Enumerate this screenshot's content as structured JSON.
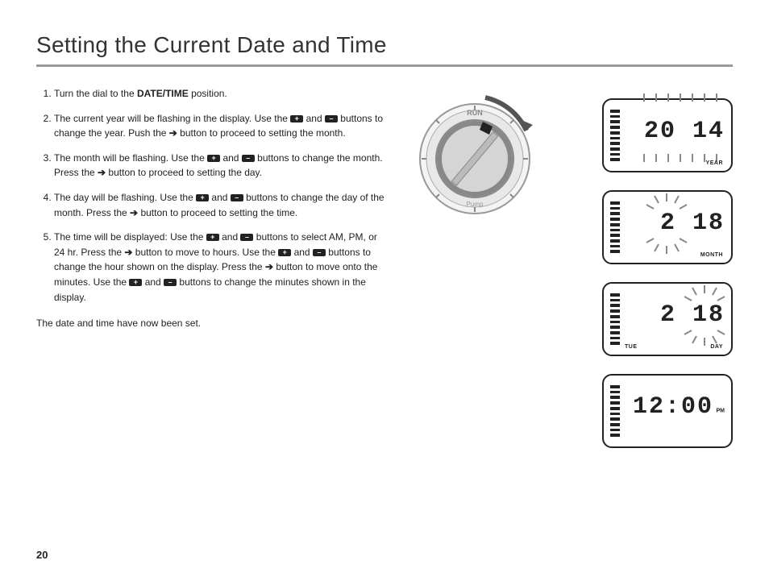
{
  "title": "Setting the Current Date and Time",
  "steps": {
    "s1_a": "Turn the dial to the ",
    "s1_bold": "DATE/TIME",
    "s1_b": " position.",
    "s2_a": "The current year will be flashing in the display. Use the ",
    "s2_b": " and ",
    "s2_c": " buttons to change the year. Push the ",
    "s2_d": " button to proceed to setting the month.",
    "s3_a": "The month will be flashing. Use the ",
    "s3_b": " and ",
    "s3_c": " buttons to change the month. Press the ",
    "s3_d": " button to proceed to setting the day.",
    "s4_a": "The day will be flashing. Use the ",
    "s4_b": " and ",
    "s4_c": " buttons to change the day of the month. Press the ",
    "s4_d": " button to proceed to setting the time.",
    "s5_a": "The time will be displayed: Use the ",
    "s5_b": " and ",
    "s5_c": " buttons to select AM, PM, or 24 hr. Press the ",
    "s5_d": " button to move to hours. Use the ",
    "s5_e": " and ",
    "s5_f": " buttons to change the hour shown on the display. Press the ",
    "s5_g": " button to move onto the minutes. Use the ",
    "s5_h": " and ",
    "s5_i": " buttons to change the minutes shown in the display."
  },
  "closing": "The date and time have now been set.",
  "dial": {
    "top_label": "RUN",
    "bottom_label": "Pump"
  },
  "icons": {
    "plus": "+",
    "minus": "–",
    "arrow": "➔"
  },
  "displays": {
    "year": {
      "value": "20 14",
      "label": "YEAR"
    },
    "month": {
      "value": "2 18",
      "label": "MONTH"
    },
    "day": {
      "value": "2 18",
      "label": "DAY",
      "weekday": "TUE"
    },
    "time": {
      "value": "12:00",
      "pm": "PM"
    }
  },
  "page_number": "20"
}
